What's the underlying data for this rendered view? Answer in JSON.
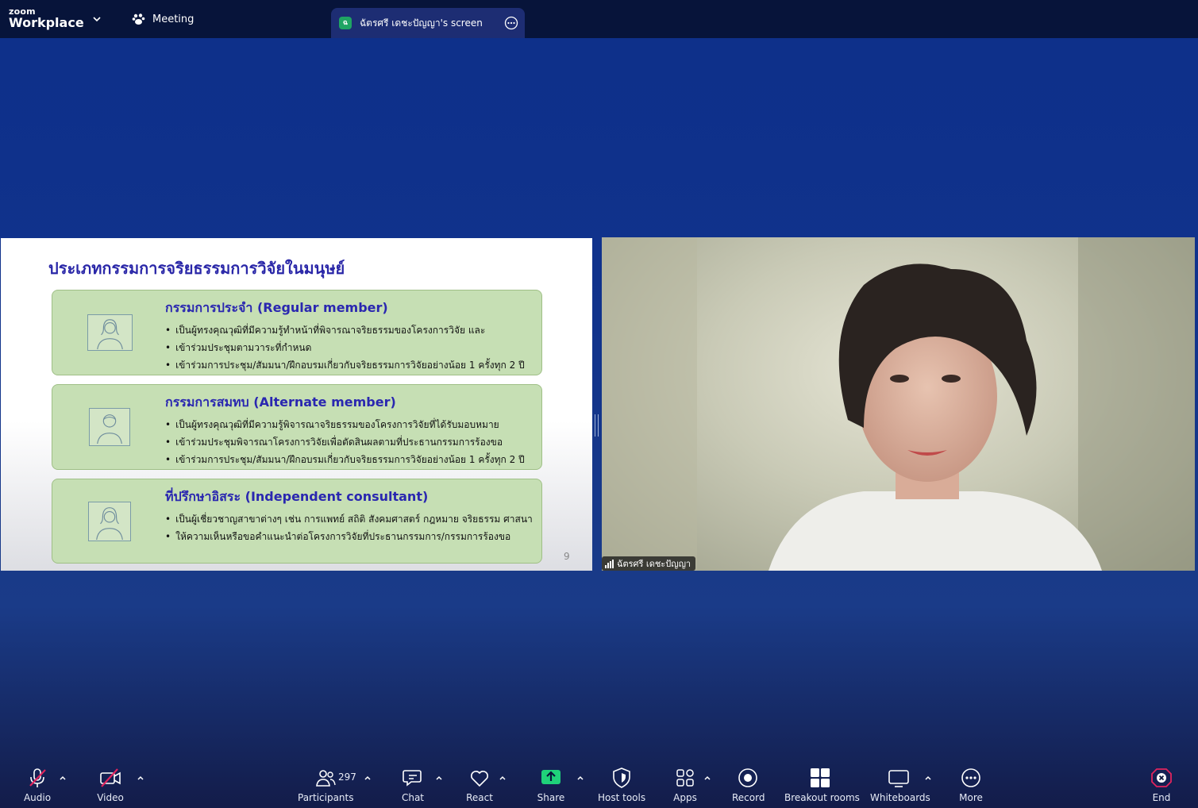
{
  "app": {
    "logo_small": "zoom",
    "logo_big": "Workplace"
  },
  "tabs": {
    "meeting_label": "Meeting",
    "share_label": "ฉัตรศรี เดชะปัญญา's screen"
  },
  "slide": {
    "title": "ประเภทกรรมการจริยธรรมการวิจัยในมนุษย์",
    "page_number": "9",
    "cards": [
      {
        "title": "กรรมการประจำ (Regular member)",
        "bullets": [
          "เป็นผู้ทรงคุณวุฒิที่มีความรู้ทำหน้าที่พิจารณาจริยธรรมของโครงการวิจัย และ",
          "เข้าร่วมประชุมตามวาระที่กำหนด",
          "เข้าร่วมการประชุม/สัมมนา/ฝึกอบรมเกี่ยวกับจริยธรรมการวิจัยอย่างน้อย 1 ครั้งทุก 2 ปี"
        ]
      },
      {
        "title": "กรรมการสมทบ (Alternate member)",
        "bullets": [
          "เป็นผู้ทรงคุณวุฒิที่มีความรู้พิจารณาจริยธรรมของโครงการวิจัยที่ได้รับมอบหมาย",
          "เข้าร่วมประชุมพิจารณาโครงการวิจัยเพื่อตัดสินผลตามที่ประธานกรรมการร้องขอ",
          "เข้าร่วมการประชุม/สัมมนา/ฝึกอบรมเกี่ยวกับจริยธรรมการวิจัยอย่างน้อย 1 ครั้งทุก 2 ปี"
        ]
      },
      {
        "title": "ที่ปรึกษาอิสระ (Independent consultant)",
        "bullets": [
          "เป็นผู้เชี่ยวชาญสาขาต่างๆ เช่น การแพทย์ สถิติ สังคมศาสตร์ กฎหมาย จริยธรรม ศาสนา",
          "ให้ความเห็นหรือขอคำแนะนำต่อโครงการวิจัยที่ประธานกรรมการ/กรรมการร้องขอ"
        ]
      }
    ]
  },
  "video": {
    "participant_name": "ฉัตรศรี เดชะปัญญา"
  },
  "toolbar": {
    "audio": "Audio",
    "video": "Video",
    "participants": "Participants",
    "participants_count": "297",
    "chat": "Chat",
    "react": "React",
    "share": "Share",
    "host_tools": "Host tools",
    "apps": "Apps",
    "record": "Record",
    "breakout_rooms": "Breakout rooms",
    "whiteboards": "Whiteboards",
    "more": "More",
    "end": "End"
  },
  "colors": {
    "share_green": "#1fa463",
    "end_red": "#e0245e",
    "slide_title_blue": "#2a27a8",
    "card_green": "#c6dfb4"
  }
}
